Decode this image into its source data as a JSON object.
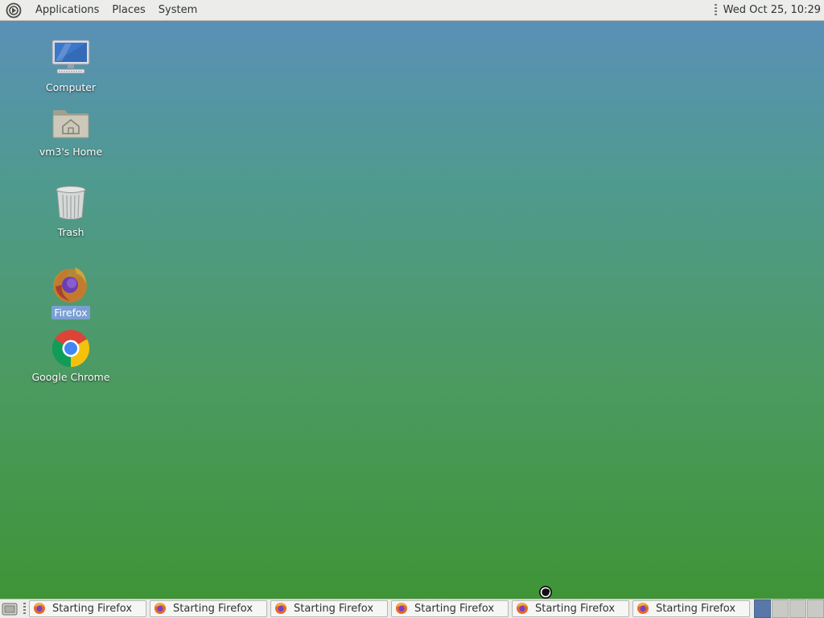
{
  "top_panel": {
    "menus": [
      "Applications",
      "Places",
      "System"
    ],
    "clock": "Wed Oct 25, 10:29"
  },
  "desktop": {
    "icons": [
      {
        "label": "Computer",
        "icon": "computer-icon"
      },
      {
        "label": "vm3's Home",
        "icon": "home-folder-icon"
      },
      {
        "label": "Trash",
        "icon": "trash-icon"
      },
      {
        "label": "Firefox",
        "icon": "firefox-icon",
        "selected": true
      },
      {
        "label": "Google Chrome",
        "icon": "chrome-icon"
      }
    ]
  },
  "taskbar": {
    "tasks": [
      {
        "label": "Starting Firefox"
      },
      {
        "label": "Starting Firefox"
      },
      {
        "label": "Starting Firefox"
      },
      {
        "label": "Starting Firefox"
      },
      {
        "label": "Starting Firefox"
      },
      {
        "label": "Starting Firefox"
      }
    ],
    "workspace_count": 4,
    "active_workspace": 1
  },
  "colors": {
    "panel_bg": "#ececea",
    "selection": "#7b9fd3",
    "wallpaper_top": "#5b8fbc",
    "wallpaper_bottom": "#3e9433"
  }
}
